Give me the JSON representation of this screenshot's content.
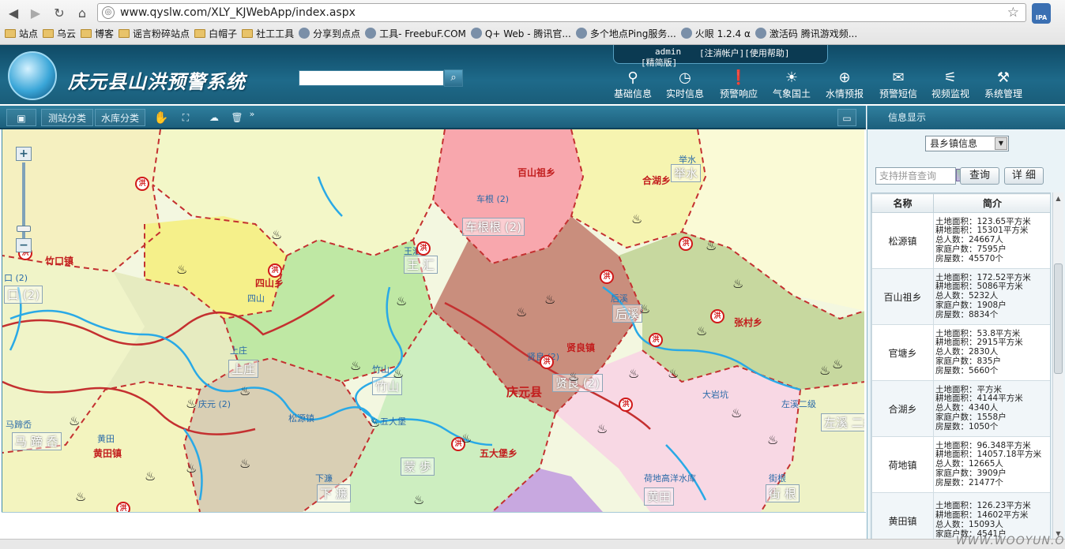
{
  "browser": {
    "url": "www.qyslw.com/XLY_KJWebApp/index.aspx",
    "ipa_label": "IPA",
    "bookmarks": [
      "站点",
      "乌云",
      "博客",
      "谣言粉碎站点",
      "白帽子",
      "社工工具",
      "分享到点点",
      "工具- FreebuF.COM",
      "Q+ Web - 腾讯官...",
      "多个地点Ping服务...",
      "火眼 1.2.4 α",
      "激活码 腾讯游戏频..."
    ]
  },
  "header": {
    "title": "庆元县山洪预警系统",
    "user": "admin",
    "logout": "[注消帐户]",
    "help": "[使用帮助]",
    "edition": "[精简版]",
    "menu": [
      {
        "label": "基础信息",
        "icon": "pin-icon"
      },
      {
        "label": "实时信息",
        "icon": "clock-icon"
      },
      {
        "label": "预警响应",
        "icon": "alert-icon"
      },
      {
        "label": "气象国土",
        "icon": "sun-icon"
      },
      {
        "label": "水情预报",
        "icon": "globe-icon"
      },
      {
        "label": "预警短信",
        "icon": "mail-icon"
      },
      {
        "label": "视频监视",
        "icon": "camera-icon"
      },
      {
        "label": "系统管理",
        "icon": "tools-icon"
      }
    ]
  },
  "toolbar": {
    "station_class": "测站分类",
    "reservoir_class": "水库分类"
  },
  "map": {
    "towns": [
      {
        "name": "百山祖乡"
      },
      {
        "name": "合湖乡"
      },
      {
        "name": "四山乡"
      },
      {
        "name": "竹口镇"
      },
      {
        "name": "贤良镇"
      },
      {
        "name": "庆元县"
      },
      {
        "name": "张村乡"
      },
      {
        "name": "五大堡乡"
      },
      {
        "name": "黄田镇"
      }
    ],
    "stations": [
      "车根 (2)",
      "王汇",
      "口 (2)",
      "四山",
      "上庄",
      "竹山",
      "后溪",
      "贤良 (2)",
      "左溪二级",
      "五大堡",
      "马蹄岙",
      "下濂",
      "荷地高洋水库",
      "举水",
      "庆元 (2)",
      "松源镇",
      "大岩坑",
      "黄田",
      "街根"
    ],
    "station_boxes": [
      "车根根 (2)",
      "王 汇",
      "口 (2)",
      "上庄",
      "竹山",
      "后溪",
      "贤良 (2)",
      "马 蹄 岙",
      "下 濂",
      "蒙 歩",
      "左溪 二级",
      "街 根",
      "举水",
      "黄田"
    ]
  },
  "panel": {
    "title": "信息显示",
    "select_value": "县乡镇信息",
    "search_placeholder": "支持拼音查询",
    "query_button": "查询",
    "detail_button": "详 细",
    "col_name": "名称",
    "col_intro": "简介",
    "rows": [
      {
        "name": "松源镇",
        "lines": [
          "土地面积：123.65平方米",
          "耕地面积：15301平方米",
          "总人数：24667人",
          "家庭户数：7595户",
          "房屋数：45570个"
        ]
      },
      {
        "name": "百山祖乡",
        "lines": [
          "土地面积：172.52平方米",
          "耕地面积：5086平方米",
          "总人数：5232人",
          "家庭户数：1908户",
          "房屋数：8834个"
        ]
      },
      {
        "name": "官塘乡",
        "lines": [
          "土地面积：53.8平方米",
          "耕地面积：2915平方米",
          "总人数：2830人",
          "家庭户数：835户",
          "房屋数：5660个"
        ]
      },
      {
        "name": "合湖乡",
        "lines": [
          "土地面积：平方米",
          "耕地面积：4144平方米",
          "总人数：4340人",
          "家庭户数：1558户",
          "房屋数：1050个"
        ]
      },
      {
        "name": "荷地镇",
        "lines": [
          "土地面积：96.348平方米",
          "耕地面积：14057.18平方米",
          "总人数：12665人",
          "家庭户数：3909户",
          "房屋数：21477个"
        ]
      },
      {
        "name": "黄田镇",
        "lines": [
          "土地面积：126.23平方米",
          "耕地面积：14602平方米",
          "总人数：15093人",
          "家庭户数：4541户"
        ]
      }
    ]
  },
  "watermark": "WWW.WOOYUN.ORG"
}
